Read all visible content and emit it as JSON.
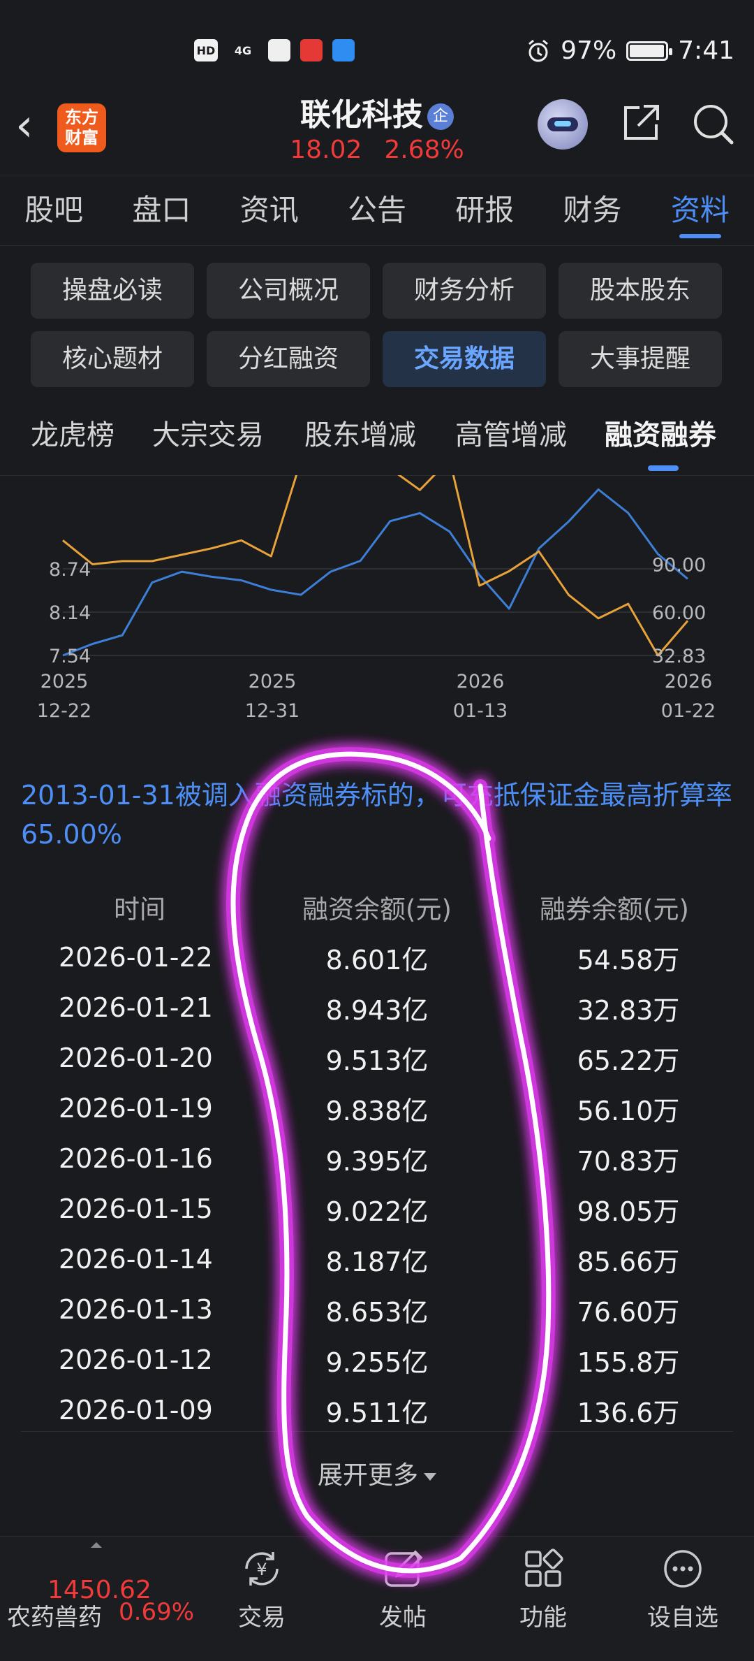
{
  "status_bar": {
    "network": "HD",
    "signal": "4G",
    "alarm": "alarm-icon",
    "battery_pct": "97%",
    "battery_level": 0.97,
    "time": "7:41"
  },
  "header": {
    "brand_line1": "东方",
    "brand_line2": "财富",
    "stock_name": "联化科技",
    "badge": "企",
    "price": "18.02",
    "change_pct": "2.68%"
  },
  "main_tabs": [
    "股吧",
    "盘口",
    "资讯",
    "公告",
    "研报",
    "财务",
    "资料"
  ],
  "main_tab_active": "资料",
  "info_buttons": [
    "操盘必读",
    "公司概况",
    "财务分析",
    "股本股东",
    "核心题材",
    "分红融资",
    "交易数据",
    "大事提醒"
  ],
  "info_button_active": "交易数据",
  "sub_tabs": [
    "龙虎榜",
    "大宗交易",
    "股东增减",
    "高管增减",
    "融资融券"
  ],
  "sub_tab_active": "融资融券",
  "chart_data": {
    "type": "line",
    "x_ticks": [
      [
        "2025",
        "12-22"
      ],
      [
        "2025",
        "12-31"
      ],
      [
        "2026",
        "01-13"
      ],
      [
        "2026",
        "01-22"
      ]
    ],
    "left_ticks": [
      "8.74",
      "8.14",
      "7.54"
    ],
    "right_ticks": [
      "90.00",
      "60.00",
      "32.83"
    ],
    "ylim_left": [
      7.54,
      9.84
    ],
    "ylim_right": [
      32.83,
      155.8
    ],
    "series": [
      {
        "axis": "left",
        "color": "#3d7fd6",
        "x": [
          "2025-12-22",
          "2025-12-23",
          "2025-12-24",
          "2025-12-25",
          "2025-12-26",
          "2025-12-29",
          "2025-12-30",
          "2025-12-31",
          "2026-01-05",
          "2026-01-06",
          "2026-01-07",
          "2026-01-08",
          "2026-01-09",
          "2026-01-12",
          "2026-01-13",
          "2026-01-14",
          "2026-01-15",
          "2026-01-16",
          "2026-01-19",
          "2026-01-20",
          "2026-01-21",
          "2026-01-22"
        ],
        "values": [
          7.54,
          7.7,
          7.82,
          8.55,
          8.7,
          8.63,
          8.58,
          8.45,
          8.38,
          8.7,
          8.85,
          9.4,
          9.511,
          9.255,
          8.653,
          8.187,
          9.022,
          9.395,
          9.838,
          9.513,
          8.943,
          8.601
        ]
      },
      {
        "axis": "right",
        "color": "#e7a23a",
        "x": [
          "2025-12-22",
          "2025-12-23",
          "2025-12-24",
          "2025-12-25",
          "2025-12-26",
          "2025-12-29",
          "2025-12-30",
          "2025-12-31",
          "2026-01-05",
          "2026-01-06",
          "2026-01-07",
          "2026-01-08",
          "2026-01-09",
          "2026-01-12",
          "2026-01-13",
          "2026-01-14",
          "2026-01-15",
          "2026-01-16",
          "2026-01-19",
          "2026-01-20",
          "2026-01-21",
          "2026-01-22"
        ],
        "values": [
          105,
          90,
          92,
          92,
          96,
          100,
          105,
          95,
          155,
          150,
          148,
          150,
          136.6,
          155.8,
          76.6,
          85.66,
          98.05,
          70.83,
          56.1,
          65.22,
          32.83,
          54.58
        ]
      }
    ]
  },
  "notice": "2013-01-31被调入融资融券标的，可充抵保证金最高折算率65.00%",
  "table": {
    "headers": [
      "时间",
      "融资余额(元)",
      "融券余额(元)"
    ],
    "rows": [
      [
        "2026-01-22",
        "8.601亿",
        "54.58万"
      ],
      [
        "2026-01-21",
        "8.943亿",
        "32.83万"
      ],
      [
        "2026-01-20",
        "9.513亿",
        "65.22万"
      ],
      [
        "2026-01-19",
        "9.838亿",
        "56.10万"
      ],
      [
        "2026-01-16",
        "9.395亿",
        "70.83万"
      ],
      [
        "2026-01-15",
        "9.022亿",
        "98.05万"
      ],
      [
        "2026-01-14",
        "8.187亿",
        "85.66万"
      ],
      [
        "2026-01-13",
        "8.653亿",
        "76.60万"
      ],
      [
        "2026-01-12",
        "9.255亿",
        "155.8万"
      ],
      [
        "2026-01-09",
        "9.511亿",
        "136.6万"
      ]
    ]
  },
  "expand_label": "展开更多",
  "bottom_bar": {
    "index_value": "1450.62",
    "index_name": "农药兽药",
    "index_change": "0.69%",
    "items": [
      {
        "label": "交易",
        "icon": "trade-icon"
      },
      {
        "label": "发帖",
        "icon": "post-icon"
      },
      {
        "label": "功能",
        "icon": "grid-icon"
      },
      {
        "label": "设自选",
        "icon": "more-icon"
      }
    ]
  },
  "colors": {
    "accent": "#4d8ff6",
    "up": "#f23a3a",
    "background": "#1a1b1e",
    "annotation": "#e23bf0"
  }
}
